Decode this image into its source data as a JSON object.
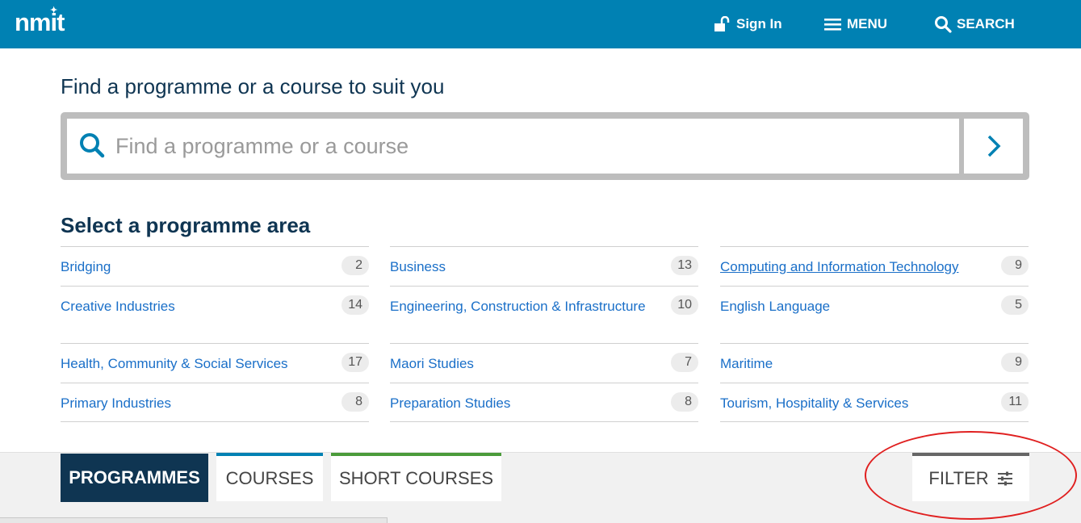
{
  "header": {
    "logo": "nmit",
    "signin_label": "Sign In",
    "menu_label": "MENU",
    "search_label": "SEARCH",
    "bg_color": "#0081b3"
  },
  "main": {
    "title": "Find a programme or a course to suit you",
    "search": {
      "placeholder": "Find a programme or a course",
      "value": ""
    }
  },
  "programme_area": {
    "title": "Select a programme area",
    "columns": [
      [
        {
          "label": "Bridging",
          "count": "2"
        },
        {
          "label": "Creative Industries",
          "count": "14"
        },
        {
          "label": "Health, Community & Social Services",
          "count": "17"
        },
        {
          "label": "Primary Industries",
          "count": "8"
        }
      ],
      [
        {
          "label": "Business",
          "count": "13"
        },
        {
          "label": "Engineering, Construction & Infrastructure",
          "count": "10"
        },
        {
          "label": "Maori Studies",
          "count": "7"
        },
        {
          "label": "Preparation Studies",
          "count": "8"
        }
      ],
      [
        {
          "label": "Computing and Information Technology",
          "count": "9"
        },
        {
          "label": "English Language",
          "count": "5"
        },
        {
          "label": "Maritime",
          "count": "9"
        },
        {
          "label": "Tourism, Hospitality & Services",
          "count": "11"
        }
      ]
    ]
  },
  "tabs": {
    "programmes": "PROGRAMMES",
    "courses": "COURSES",
    "short_courses": "SHORT COURSES",
    "filter": "FILTER",
    "active": "PROGRAMMES",
    "colors": {
      "programmes": "#0f3552",
      "courses": "#0081b3",
      "short_courses": "#4a9b3a",
      "filter": "#666666"
    }
  },
  "icons": {
    "signin": "unlock-icon",
    "menu": "hamburger-icon",
    "search": "search-icon",
    "go": "chevron-right-icon",
    "filter": "sliders-icon"
  },
  "annotation": {
    "color": "#e02020",
    "target": "filter-button"
  }
}
